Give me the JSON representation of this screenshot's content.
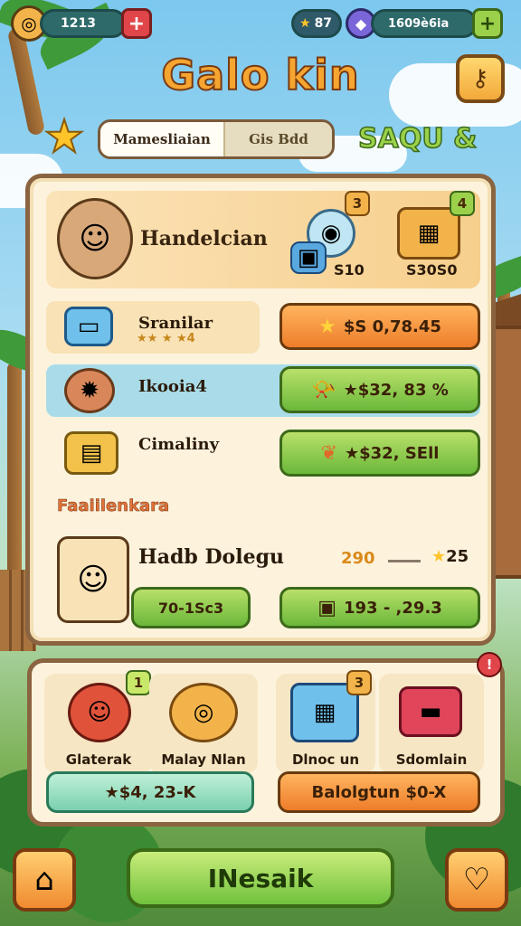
{
  "hud": {
    "coins_value": "1213",
    "stars_value": "87",
    "gems_value": "1609è6ia",
    "add_label": "+"
  },
  "header": {
    "title": "Galo kin",
    "tab_active": "Mamesliaian",
    "tab_inactive": "Gis Bdd",
    "side_label": "SAQU &"
  },
  "hero": {
    "name": "Handelcian",
    "item1_value": "S10",
    "item1_badge": "3",
    "item2_value": "S30S0",
    "item2_badge": "4"
  },
  "rows": [
    {
      "label": "Sranilar",
      "stars": "★★ ★ ★4",
      "price": "$S 0,78.45",
      "icon": "star"
    },
    {
      "label": "Ikooia4",
      "stars": "",
      "price": "★$32, 83 %",
      "icon": "horn"
    },
    {
      "label": "Cimaliny",
      "stars": "",
      "price": "★$32, SEll",
      "icon": "leaf"
    }
  ],
  "section_label": "Faaiilenkara",
  "hero2": {
    "name": "Hadb Dolegu",
    "stat_left": "290",
    "stat_right": "25",
    "btn_left": "70-1Sc3",
    "btn_right": "193 - ,29.3"
  },
  "shop": {
    "items": [
      {
        "name": "Glaterak",
        "badge": "1"
      },
      {
        "name": "Malay Nlan",
        "badge": ""
      },
      {
        "name": "Dlnoc un",
        "badge": "3"
      },
      {
        "name": "Sdomlain",
        "badge": ""
      }
    ],
    "price_left": "★$4, 23-K",
    "price_right": "Balolgtun $0-X",
    "close_badge": "!"
  },
  "nav": {
    "main_label": "INesaik"
  },
  "colors": {
    "accent_orange": "#f08a30",
    "accent_green": "#71c23e",
    "panel_bg": "#fdf3dd",
    "panel_border": "#8a6340"
  }
}
